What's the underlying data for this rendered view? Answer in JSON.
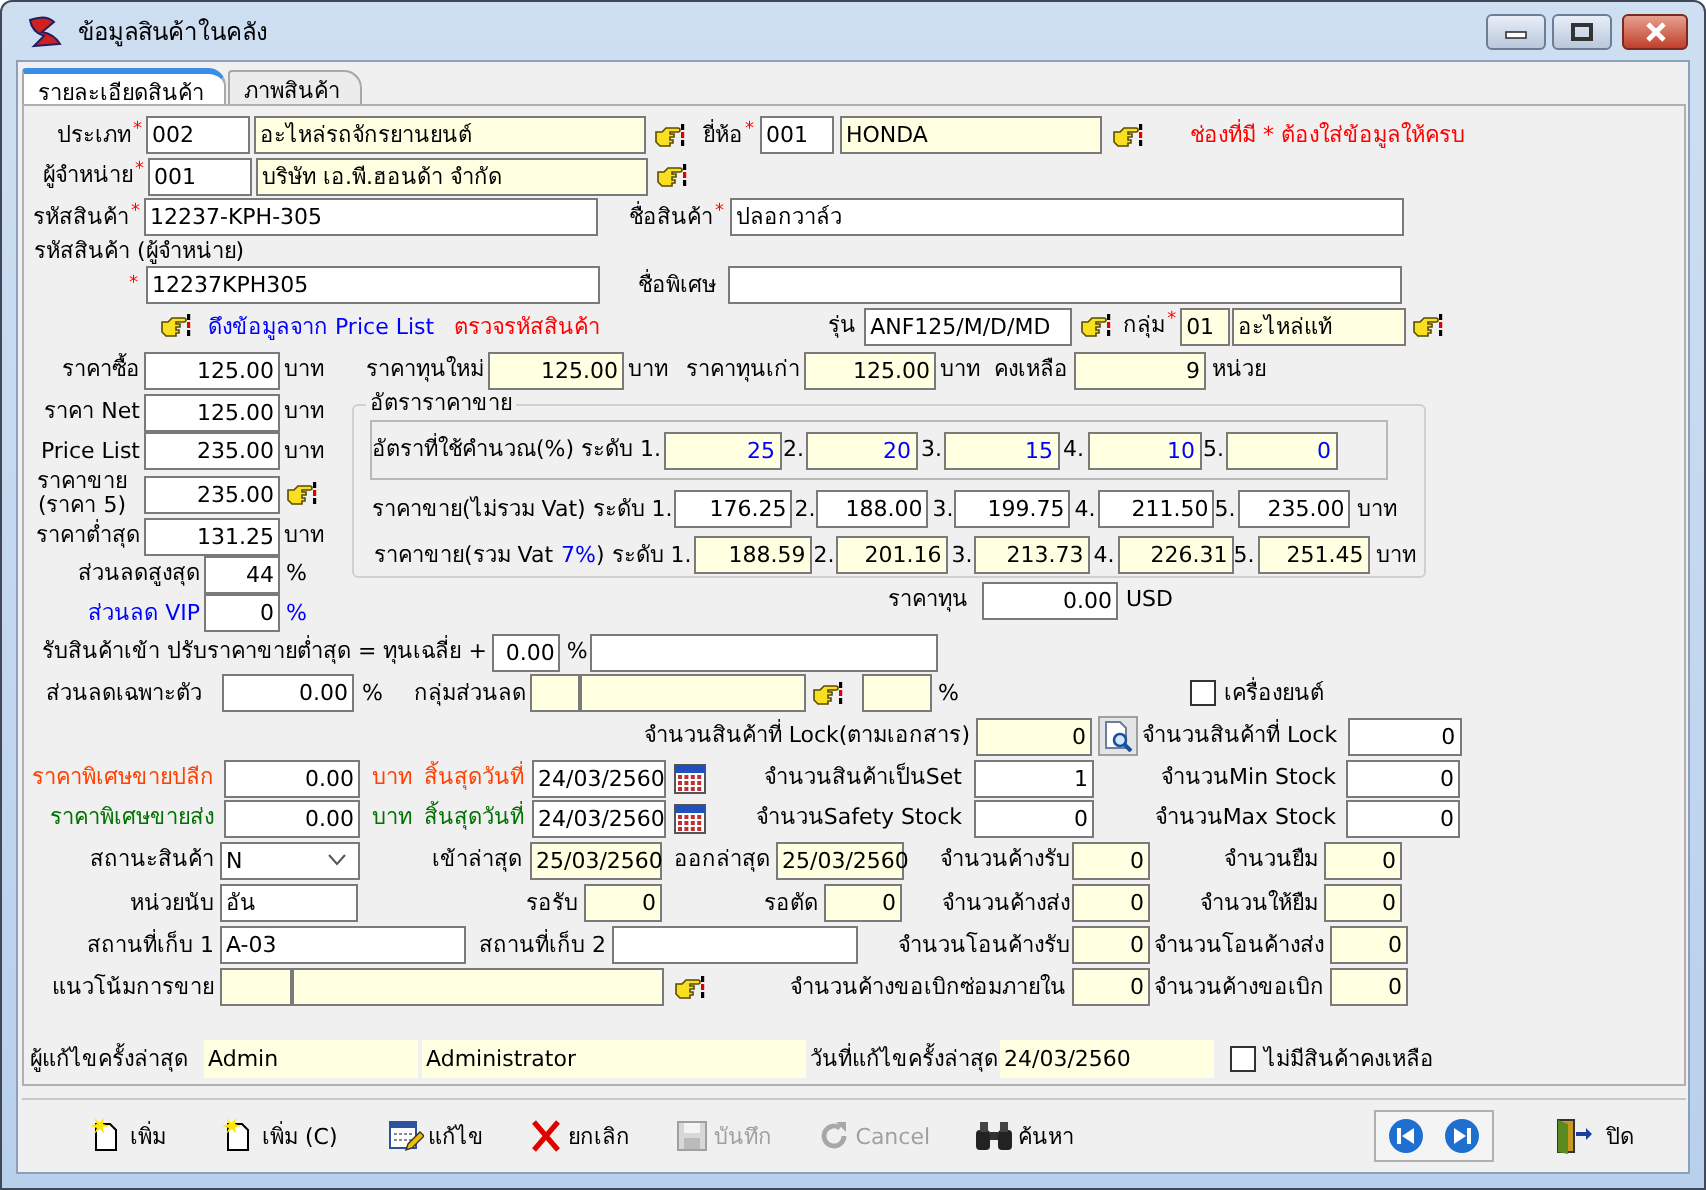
{
  "window": {
    "title": "ข้อมูลสินค้าในคลัง"
  },
  "tabs": [
    {
      "label": "รายละเอียดสินค้า",
      "selected": true
    },
    {
      "label": "ภาพสินค้า",
      "selected": false
    }
  ],
  "form": {
    "top_rows": [
      {
        "items": [
          {
            "kind": "label",
            "text": "ประเภท",
            "mark": "*"
          },
          {
            "kind": "field",
            "value": "002",
            "readonly": false
          },
          {
            "kind": "field",
            "value": "อะไหล่รถจักรยานยนต์",
            "readonly": true
          },
          {
            "kind": "lookup"
          },
          {
            "kind": "label",
            "text": "ยี่ห้อ",
            "mark": "*"
          },
          {
            "kind": "field",
            "value": "001",
            "readonly": false
          },
          {
            "kind": "field",
            "value": "HONDA",
            "readonly": true
          },
          {
            "kind": "lookup"
          },
          {
            "kind": "label",
            "text": "ช่องที่มี * ต้องใส่ข้อมูลให้ครบ",
            "color": "#ff0000"
          }
        ]
      },
      {
        "items": [
          {
            "kind": "label",
            "text": "ผู้จำหน่าย",
            "mark": "*"
          },
          {
            "kind": "field",
            "value": "001",
            "readonly": false
          },
          {
            "kind": "field",
            "value": "บริษัท เอ.พี.ฮอนด้า จำกัด",
            "readonly": true
          },
          {
            "kind": "lookup"
          }
        ]
      },
      {
        "items": [
          {
            "kind": "label",
            "text": "รหัสสินค้า",
            "mark": "*"
          },
          {
            "kind": "field",
            "value": "12237-KPH-305",
            "readonly": false
          },
          {
            "kind": "label",
            "text": "ชื่อสินค้า",
            "mark": "*"
          },
          {
            "kind": "field",
            "value": "ปลอกวาล์ว",
            "readonly": false
          }
        ]
      },
      {
        "items": [
          {
            "kind": "label",
            "text": "รหัสสินค้า (ผู้จำหน่าย)"
          }
        ]
      },
      {
        "items": [
          {
            "kind": "label",
            "mark": "*"
          },
          {
            "kind": "field",
            "value": "12237KPH305",
            "readonly": false
          },
          {
            "kind": "label",
            "text": "ชื่อพิเศษ"
          },
          {
            "kind": "field",
            "readonly": false
          }
        ]
      },
      {
        "items": [
          {
            "kind": "lookup"
          },
          {
            "kind": "link",
            "text": "ดึงข้อมูลจาก Price List",
            "color": "#0000ff"
          },
          {
            "kind": "link",
            "text": "ตรวจรหัสสินค้า",
            "color": "#ff0000"
          },
          {
            "kind": "label",
            "text": "รุ่น"
          },
          {
            "kind": "field",
            "value": "ANF125/M/D/MD",
            "readonly": false
          },
          {
            "kind": "lookup"
          },
          {
            "kind": "label",
            "text": "กลุ่ม",
            "mark": "*"
          },
          {
            "kind": "field",
            "value": "01",
            "readonly": true
          },
          {
            "kind": "field",
            "value": "อะไหล่แท้",
            "readonly": true
          },
          {
            "kind": "lookup"
          }
        ]
      },
      {
        "items": [
          {
            "kind": "label",
            "text": "ราคาซื้อ"
          },
          {
            "kind": "number",
            "value": "125.00",
            "readonly": false
          },
          {
            "kind": "label",
            "text": "บาท"
          },
          {
            "kind": "label",
            "text": "ราคาทุนใหม่"
          },
          {
            "kind": "number",
            "value": "125.00",
            "readonly": true
          },
          {
            "kind": "label",
            "text": "บาท"
          },
          {
            "kind": "label",
            "text": "ราคาทุนเก่า"
          },
          {
            "kind": "number",
            "value": "125.00",
            "readonly": true
          },
          {
            "kind": "label",
            "text": "บาท"
          },
          {
            "kind": "label",
            "text": "คงเหลือ"
          },
          {
            "kind": "number",
            "value": "9",
            "readonly": true
          },
          {
            "kind": "label",
            "text": "หน่วย"
          }
        ]
      }
    ],
    "price_rows": [
      {
        "items": [
          {
            "kind": "label",
            "text": "ราคา Net"
          },
          {
            "kind": "number",
            "value": "125.00",
            "readonly": false
          },
          {
            "kind": "label",
            "text": "บาท"
          }
        ]
      },
      {
        "items": [
          {
            "kind": "label",
            "text": "Price List"
          },
          {
            "kind": "number",
            "value": "235.00",
            "readonly": false
          },
          {
            "kind": "label",
            "text": "บาท"
          }
        ]
      },
      {
        "items": [
          {
            "kind": "label",
            "text": "ราคาขาย (ราคา 5)"
          },
          {
            "kind": "number",
            "value": "235.00",
            "readonly": false
          },
          {
            "kind": "lookup"
          }
        ]
      },
      {
        "items": [
          {
            "kind": "label",
            "text": "ราคาต่ำสุด"
          },
          {
            "kind": "number",
            "value": "131.25",
            "readonly": false
          },
          {
            "kind": "label",
            "text": "บาท"
          }
        ]
      },
      {
        "items": [
          {
            "kind": "label",
            "text": "ส่วนลดสูงสุด"
          },
          {
            "kind": "number",
            "value": "44",
            "readonly": false
          },
          {
            "kind": "label",
            "text": "%"
          }
        ]
      },
      {
        "items": [
          {
            "kind": "label",
            "text": "ส่วนลด VIP",
            "color": "#0000ff"
          },
          {
            "kind": "number",
            "value": "0",
            "readonly": false
          },
          {
            "kind": "label",
            "text": "%",
            "color": "#0000ff"
          }
        ]
      }
    ],
    "price_table": {
      "title": "อัตราราคาขาย",
      "rate_row": {
        "items": [
          {
            "kind": "label",
            "text": "อัตราที่ใช้คำนวณ(%) ระดับ 1."
          },
          {
            "kind": "number",
            "value": "25",
            "readonly": true,
            "color": "#0000ff"
          },
          {
            "kind": "label",
            "text": "2."
          },
          {
            "kind": "number",
            "value": "20",
            "readonly": true,
            "color": "#0000ff"
          },
          {
            "kind": "label",
            "text": "3."
          },
          {
            "kind": "number",
            "value": "15",
            "readonly": true,
            "color": "#0000ff"
          },
          {
            "kind": "label",
            "text": "4."
          },
          {
            "kind": "number",
            "value": "10",
            "readonly": true,
            "color": "#0000ff"
          },
          {
            "kind": "label",
            "text": "5."
          },
          {
            "kind": "number",
            "value": "0",
            "readonly": true,
            "color": "#0000ff"
          }
        ]
      },
      "rows": [
        {
          "items": [
            {
              "kind": "label",
              "text": "ราคาขาย(ไม่รวม Vat) ระดับ 1."
            },
            {
              "kind": "number",
              "value": "176.25",
              "readonly": false
            },
            {
              "kind": "label",
              "text": "2."
            },
            {
              "kind": "number",
              "value": "188.00",
              "readonly": false
            },
            {
              "kind": "label",
              "text": "3."
            },
            {
              "kind": "number",
              "value": "199.75",
              "readonly": false
            },
            {
              "kind": "label",
              "text": "4."
            },
            {
              "kind": "number",
              "value": "211.50",
              "readonly": false
            },
            {
              "kind": "label",
              "text": "5."
            },
            {
              "kind": "number",
              "value": "235.00",
              "readonly": false
            },
            {
              "kind": "label",
              "text": "บาท"
            }
          ]
        },
        {
          "items": [
            {
              "kind": "label",
              "text": "ราคาขาย(รวม Vat"
            },
            {
              "kind": "label",
              "text": "7%",
              "color": "#0000ff"
            },
            {
              "kind": "label",
              "text": ") ระดับ 1."
            },
            {
              "kind": "number",
              "value": "188.59",
              "readonly": true
            },
            {
              "kind": "label",
              "text": "2."
            },
            {
              "kind": "number",
              "value": "201.16",
              "readonly": true
            },
            {
              "kind": "label",
              "text": "3."
            },
            {
              "kind": "number",
              "value": "213.73",
              "readonly": true
            },
            {
              "kind": "label",
              "text": "4."
            },
            {
              "kind": "number",
              "value": "226.31",
              "readonly": true
            },
            {
              "kind": "label",
              "text": "5."
            },
            {
              "kind": "number",
              "value": "251.45",
              "readonly": true
            },
            {
              "kind": "label",
              "text": "บาท"
            }
          ]
        }
      ]
    },
    "cost_row": {
      "items": [
        {
          "kind": "label",
          "text": "ราคาทุน"
        },
        {
          "kind": "number",
          "value": "0.00",
          "readonly": false
        },
        {
          "kind": "label",
          "text": "USD"
        }
      ]
    },
    "bottom_rows": [
      {
        "items": [
          {
            "kind": "label",
            "text": "รับสินค้าเข้า ปรับราคาขายต่ำสุด = ทุนเฉลี่ย +"
          },
          {
            "kind": "number",
            "value": "0.00",
            "readonly": false
          },
          {
            "kind": "label",
            "text": "%"
          },
          {
            "kind": "field",
            "readonly": false
          }
        ]
      },
      {
        "items": [
          {
            "kind": "label",
            "text": "ส่วนลดเฉพาะตัว"
          },
          {
            "kind": "number",
            "value": "0.00",
            "readonly": false
          },
          {
            "kind": "label",
            "text": "%"
          },
          {
            "kind": "label",
            "text": "กลุ่มส่วนลด"
          },
          {
            "kind": "field",
            "readonly": true
          },
          {
            "kind": "field",
            "readonly": true
          },
          {
            "kind": "lookup"
          },
          {
            "kind": "field",
            "readonly": true
          },
          {
            "kind": "label",
            "text": "%"
          },
          {
            "kind": "checkbox",
            "text": "เครื่องยนต์",
            "checked": false
          }
        ]
      },
      {
        "items": [
          {
            "kind": "label",
            "text": "จำนวนสินค้าที่ Lock(ตามเอกสาร)"
          },
          {
            "kind": "number",
            "value": "0",
            "readonly": true
          },
          {
            "kind": "search-button"
          },
          {
            "kind": "label",
            "text": "จำนวนสินค้าที่ Lock"
          },
          {
            "kind": "number",
            "value": "0",
            "readonly": false
          }
        ]
      },
      {
        "items": [
          {
            "kind": "label",
            "text": "ราคาพิเศษขายปลีก",
            "color": "#ff4000"
          },
          {
            "kind": "number",
            "value": "0.00",
            "readonly": false
          },
          {
            "kind": "label",
            "text": "บาท",
            "color": "#ff4000"
          },
          {
            "kind": "label",
            "text": "สิ้นสุดวันที่",
            "color": "#ff4000"
          },
          {
            "kind": "field",
            "value": "24/03/2560",
            "readonly": false
          },
          {
            "kind": "calendar"
          },
          {
            "kind": "label",
            "text": "จำนวนสินค้าเป็นSet"
          },
          {
            "kind": "number",
            "value": "1",
            "readonly": false
          },
          {
            "kind": "label",
            "text": "จำนวนMin Stock"
          },
          {
            "kind": "number",
            "value": "0",
            "readonly": false
          }
        ]
      },
      {
        "items": [
          {
            "kind": "label",
            "text": "ราคาพิเศษขายส่ง",
            "color": "#007000"
          },
          {
            "kind": "number",
            "value": "0.00",
            "readonly": false
          },
          {
            "kind": "label",
            "text": "บาท",
            "color": "#007000"
          },
          {
            "kind": "label",
            "text": "สิ้นสุดวันที่",
            "color": "#007000"
          },
          {
            "kind": "field",
            "value": "24/03/2560",
            "readonly": false
          },
          {
            "kind": "calendar"
          },
          {
            "kind": "label",
            "text": "จำนวนSafety Stock"
          },
          {
            "kind": "number",
            "value": "0",
            "readonly": false
          },
          {
            "kind": "label",
            "text": "จำนวนMax Stock"
          },
          {
            "kind": "number",
            "value": "0",
            "readonly": false
          }
        ]
      },
      {
        "items": [
          {
            "kind": "label",
            "text": "สถานะสินค้า"
          },
          {
            "kind": "dropdown",
            "value": "N"
          },
          {
            "kind": "label",
            "text": "เข้าล่าสุด"
          },
          {
            "kind": "field",
            "value": "25/03/2560",
            "readonly": true
          },
          {
            "kind": "label",
            "text": "ออกล่าสุด"
          },
          {
            "kind": "field",
            "value": "25/03/2560",
            "readonly": true
          },
          {
            "kind": "label",
            "text": "จำนวนค้างรับ"
          },
          {
            "kind": "number",
            "value": "0",
            "readonly": true
          },
          {
            "kind": "label",
            "text": "จำนวนยืม"
          },
          {
            "kind": "number",
            "value": "0",
            "readonly": true
          }
        ]
      },
      {
        "items": [
          {
            "kind": "label",
            "text": "หน่วยนับ"
          },
          {
            "kind": "field",
            "value": "อัน",
            "readonly": false
          },
          {
            "kind": "label",
            "text": "รอรับ"
          },
          {
            "kind": "number",
            "value": "0",
            "readonly": true
          },
          {
            "kind": "label",
            "text": "รอตัด"
          },
          {
            "kind": "number",
            "value": "0",
            "readonly": true
          },
          {
            "kind": "label",
            "text": "จำนวนค้างส่ง"
          },
          {
            "kind": "number",
            "value": "0",
            "readonly": true
          },
          {
            "kind": "label",
            "text": "จำนวนให้ยืม"
          },
          {
            "kind": "number",
            "value": "0",
            "readonly": true
          }
        ]
      },
      {
        "items": [
          {
            "kind": "label",
            "text": "สถานที่เก็บ 1"
          },
          {
            "kind": "field",
            "value": "A-03",
            "readonly": false
          },
          {
            "kind": "label",
            "text": "สถานที่เก็บ 2"
          },
          {
            "kind": "field",
            "readonly": false
          },
          {
            "kind": "label",
            "text": "จำนวนโอนค้างรับ"
          },
          {
            "kind": "number",
            "value": "0",
            "readonly": true
          },
          {
            "kind": "label",
            "text": "จำนวนโอนค้างส่ง"
          },
          {
            "kind": "number",
            "value": "0",
            "readonly": true
          }
        ]
      },
      {
        "items": [
          {
            "kind": "label",
            "text": "แนวโน้มการขาย"
          },
          {
            "kind": "field",
            "readonly": true
          },
          {
            "kind": "field",
            "readonly": true
          },
          {
            "kind": "lookup"
          },
          {
            "kind": "label",
            "text": "จำนวนค้างขอเบิกซ่อมภายใน"
          },
          {
            "kind": "number",
            "value": "0",
            "readonly": true
          },
          {
            "kind": "label",
            "text": "จำนวนค้างขอเบิก"
          },
          {
            "kind": "number",
            "value": "0",
            "readonly": true
          }
        ]
      }
    ],
    "footer_row": {
      "items": [
        {
          "kind": "label",
          "text": "ผู้แก้ไขครั้งล่าสุด"
        },
        {
          "kind": "display",
          "value": "Admin"
        },
        {
          "kind": "display",
          "value": "Administrator"
        },
        {
          "kind": "label",
          "text": "วันที่แก้ไขครั้งล่าสุด"
        },
        {
          "kind": "display",
          "value": "24/03/2560"
        },
        {
          "kind": "checkbox",
          "text": "ไม่มีสินค้าคงเหลือ",
          "checked": false
        }
      ]
    }
  },
  "toolbar": {
    "buttons": [
      {
        "label": "เพิ่ม",
        "disabled": false
      },
      {
        "label": "เพิ่ม (C)",
        "disabled": false
      },
      {
        "label": "แก้ไข",
        "disabled": false
      },
      {
        "label": "ยกเลิก",
        "disabled": false
      },
      {
        "label": "บันทึก",
        "disabled": true
      },
      {
        "label": "Cancel",
        "disabled": true
      },
      {
        "label": "ค้นหา",
        "disabled": false
      }
    ],
    "close_button": {
      "label": "ปิด"
    }
  }
}
